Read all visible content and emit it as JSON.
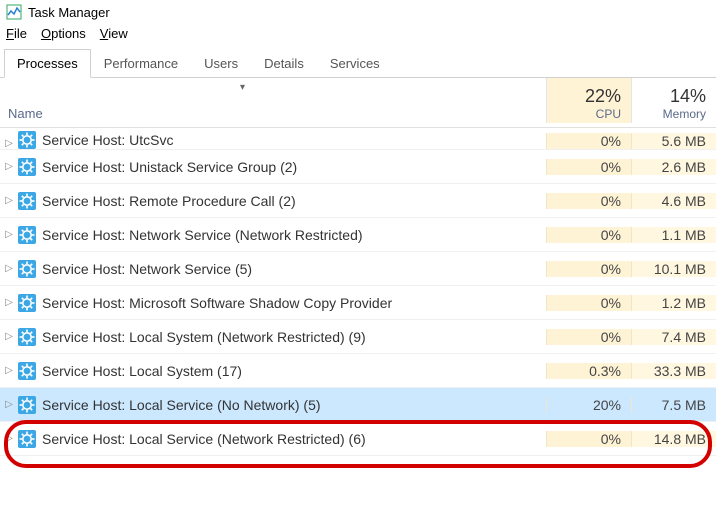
{
  "window": {
    "title": "Task Manager"
  },
  "menu": {
    "file": "File",
    "options": "Options",
    "view": "View"
  },
  "tabs": {
    "processes": "Processes",
    "performance": "Performance",
    "users": "Users",
    "details": "Details",
    "services": "Services"
  },
  "columns": {
    "name": "Name",
    "cpu": {
      "pct": "22%",
      "label": "CPU"
    },
    "memory": {
      "pct": "14%",
      "label": "Memory"
    }
  },
  "rows": [
    {
      "name": "Service Host: UtcSvc",
      "cpu": "0%",
      "mem": "5.6 MB"
    },
    {
      "name": "Service Host: Unistack Service Group (2)",
      "cpu": "0%",
      "mem": "2.6 MB"
    },
    {
      "name": "Service Host: Remote Procedure Call (2)",
      "cpu": "0%",
      "mem": "4.6 MB"
    },
    {
      "name": "Service Host: Network Service (Network Restricted)",
      "cpu": "0%",
      "mem": "1.1 MB"
    },
    {
      "name": "Service Host: Network Service (5)",
      "cpu": "0%",
      "mem": "10.1 MB"
    },
    {
      "name": "Service Host: Microsoft Software Shadow Copy Provider",
      "cpu": "0%",
      "mem": "1.2 MB"
    },
    {
      "name": "Service Host: Local System (Network Restricted) (9)",
      "cpu": "0%",
      "mem": "7.4 MB"
    },
    {
      "name": "Service Host: Local System (17)",
      "cpu": "0.3%",
      "mem": "33.3 MB"
    },
    {
      "name": "Service Host: Local Service (No Network) (5)",
      "cpu": "20%",
      "mem": "7.5 MB"
    },
    {
      "name": "Service Host: Local Service (Network Restricted) (6)",
      "cpu": "0%",
      "mem": "14.8 MB"
    }
  ],
  "selected_index": 8
}
